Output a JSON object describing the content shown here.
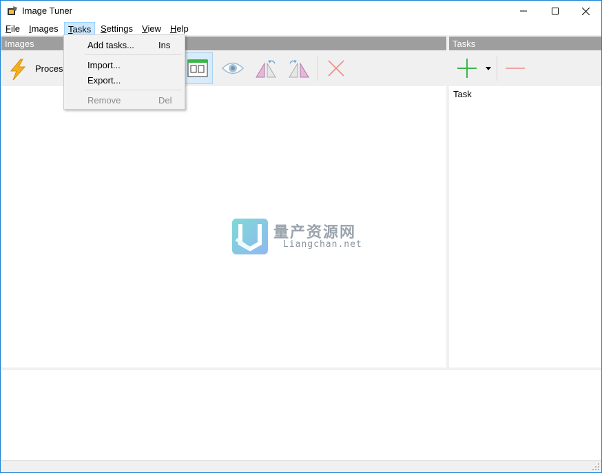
{
  "window": {
    "title": "Image Tuner",
    "controls": [
      "minimize-icon",
      "maximize-icon",
      "close-icon"
    ]
  },
  "menu": [
    {
      "key": "F",
      "rest": "ile"
    },
    {
      "key": "I",
      "rest": "mages"
    },
    {
      "key": "T",
      "rest": "asks"
    },
    {
      "key": "S",
      "rest": "ettings"
    },
    {
      "key": "V",
      "rest": "iew"
    },
    {
      "key": "H",
      "rest": "elp"
    }
  ],
  "images_panel": {
    "header": "Images",
    "toolbar": {
      "process_label": "Process",
      "icons": [
        "lightning-icon",
        "view-toggle-icon",
        "eye-icon",
        "rotate-left-icon",
        "rotate-right-icon",
        "delete-x-icon"
      ]
    }
  },
  "tasks_panel": {
    "header": "Tasks",
    "column_header": "Task",
    "icons": [
      "add-plus-icon",
      "dropdown-arrow-icon",
      "remove-minus-icon"
    ]
  },
  "tasks_menu": {
    "items": [
      {
        "label": "Add tasks...",
        "shortcut": "Ins",
        "enabled": true
      },
      {
        "label": "Import...",
        "shortcut": "",
        "enabled": true
      },
      {
        "label": "Export...",
        "shortcut": "",
        "enabled": true
      },
      {
        "label": "Remove",
        "shortcut": "Del",
        "enabled": false
      }
    ]
  },
  "watermark": {
    "cn": "量产资源网",
    "en": "Liangchan.net"
  },
  "colors": {
    "accent": "#1883d7",
    "header_gray": "#9e9e9e",
    "menu_active": "#cce8ff",
    "add_green": "#3cb44a",
    "remove_red": "#e88a8a"
  }
}
